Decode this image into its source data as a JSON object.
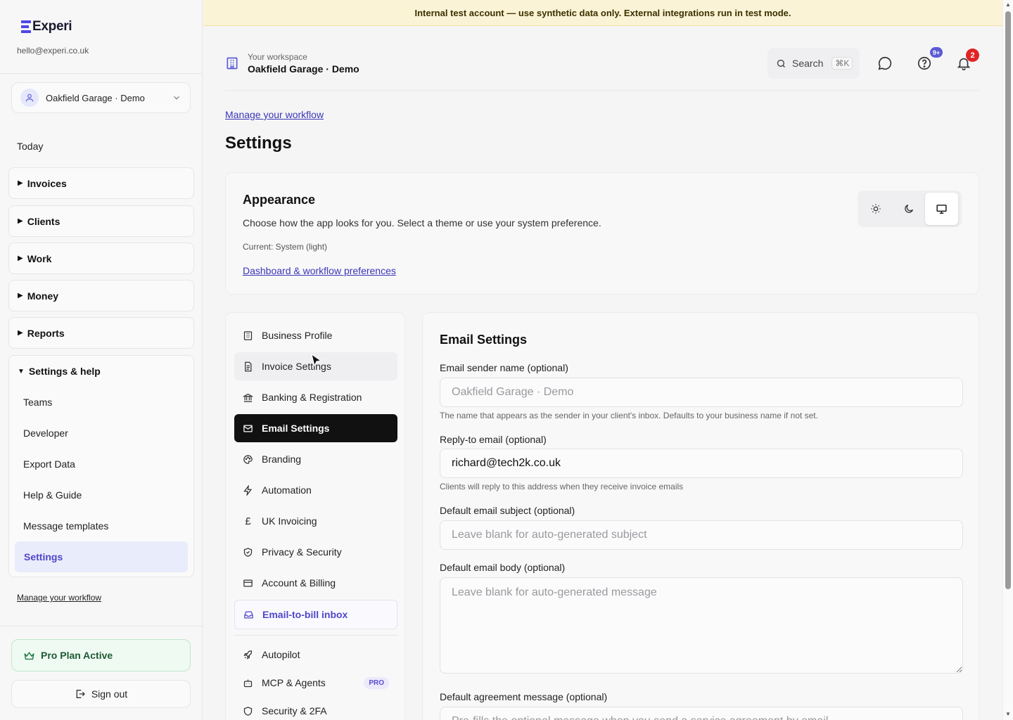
{
  "sidebar": {
    "logo": "Experi",
    "user_email": "hello@experi.co.uk",
    "workspace": "Oakfield Garage · Demo",
    "today": "Today",
    "groups": [
      "Invoices",
      "Clients",
      "Work",
      "Money",
      "Reports"
    ],
    "settings_group": {
      "label": "Settings & help",
      "items": [
        "Teams",
        "Developer",
        "Export Data",
        "Help & Guide",
        "Message templates"
      ],
      "active": "Settings"
    },
    "workflow_link": "Manage your workflow",
    "pro_plan": "Pro Plan Active",
    "sign_out": "Sign out"
  },
  "banner": "Internal test account — use synthetic data only. External integrations run in test mode.",
  "header": {
    "workspace_label": "Your workspace",
    "workspace_name": "Oakfield Garage · Demo",
    "search_label": "Search",
    "search_shortcut": "⌘K",
    "help_badge": "9+",
    "notif_badge": "2"
  },
  "page": {
    "link": "Manage your workflow",
    "title": "Settings"
  },
  "appearance": {
    "title": "Appearance",
    "description": "Choose how the app looks for you. Select a theme or use your system preference.",
    "current": "Current: System (light)",
    "link": "Dashboard & workflow preferences",
    "active_theme": "system"
  },
  "settings_nav": {
    "items": [
      {
        "label": "Business Profile",
        "icon": "building-icon"
      },
      {
        "label": "Invoice Settings",
        "icon": "document-icon"
      },
      {
        "label": "Banking & Registration",
        "icon": "bank-icon"
      },
      {
        "label": "Email Settings",
        "icon": "mail-icon"
      },
      {
        "label": "Branding",
        "icon": "palette-icon"
      },
      {
        "label": "Automation",
        "icon": "bolt-icon"
      },
      {
        "label": "UK Invoicing",
        "icon": "pound-icon"
      },
      {
        "label": "Privacy & Security",
        "icon": "shield-check-icon"
      },
      {
        "label": "Account & Billing",
        "icon": "card-icon"
      },
      {
        "label": "Email-to-bill inbox",
        "icon": "inbox-icon"
      },
      {
        "label": "Autopilot",
        "icon": "rocket-icon"
      },
      {
        "label": "MCP & Agents",
        "icon": "bot-icon"
      },
      {
        "label": "Security & 2FA",
        "icon": "shield-icon"
      }
    ],
    "pro_badge": "PRO"
  },
  "email_settings": {
    "title": "Email Settings",
    "sender_name": {
      "label": "Email sender name (optional)",
      "placeholder": "Oakfield Garage · Demo",
      "help": "The name that appears as the sender in your client's inbox. Defaults to your business name if not set."
    },
    "reply_to": {
      "label": "Reply-to email (optional)",
      "value": "richard@tech2k.co.uk",
      "help": "Clients will reply to this address when they receive invoice emails"
    },
    "subject": {
      "label": "Default email subject (optional)",
      "placeholder": "Leave blank for auto-generated subject"
    },
    "body": {
      "label": "Default email body (optional)",
      "placeholder": "Leave blank for auto-generated message"
    },
    "agreement": {
      "label": "Default agreement message (optional)",
      "placeholder": "Pre-fills the optional message when you send a service agreement by email"
    }
  }
}
